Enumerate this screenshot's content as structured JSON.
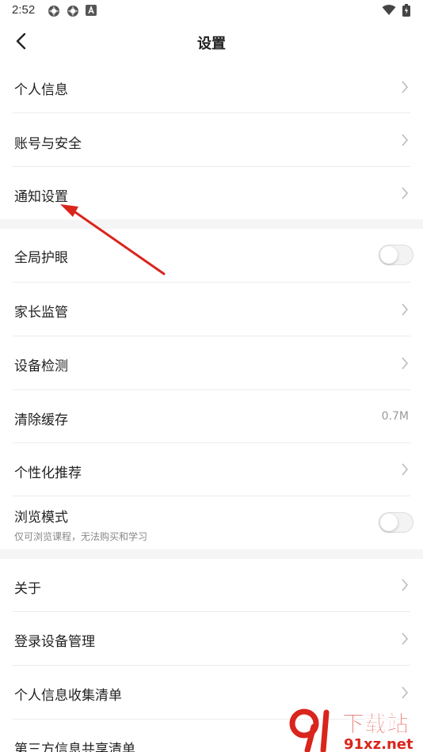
{
  "status_bar": {
    "time": "2:52"
  },
  "header": {
    "title": "设置"
  },
  "sections": [
    {
      "items": [
        {
          "label": "个人信息"
        },
        {
          "label": "账号与安全"
        },
        {
          "label": "通知设置"
        }
      ]
    },
    {
      "items": [
        {
          "label": "全局护眼",
          "toggle": false
        },
        {
          "label": "家长监管"
        },
        {
          "label": "设备检测"
        },
        {
          "label": "清除缓存",
          "value": "0.7M"
        },
        {
          "label": "个性化推荐"
        },
        {
          "label": "浏览模式",
          "sub": "仅可浏览课程，无法购买和学习",
          "toggle": false
        }
      ]
    },
    {
      "items": [
        {
          "label": "关于"
        },
        {
          "label": "登录设备管理"
        },
        {
          "label": "个人信息收集清单"
        },
        {
          "label": "第三方信息共享清单"
        }
      ]
    }
  ],
  "annotation": {
    "color": "#d9251c"
  },
  "watermark": {
    "text": "下载站",
    "url": "91xz.net",
    "color": "#d9251c"
  }
}
